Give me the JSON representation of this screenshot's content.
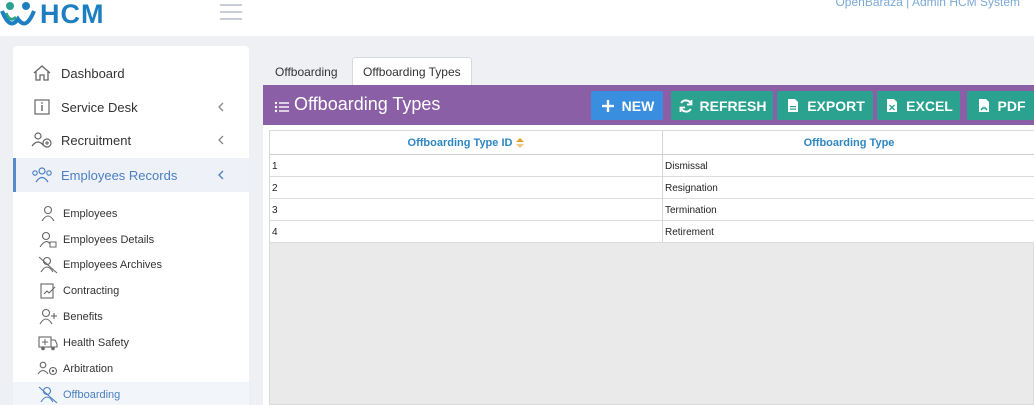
{
  "header": {
    "logo_text": "HCM",
    "system_label": "OpenBaraza | Admin HCM System"
  },
  "sidebar": {
    "items": [
      {
        "label": "Dashboard",
        "icon": "home-icon",
        "has_chevron": false
      },
      {
        "label": "Service Desk",
        "icon": "info-icon",
        "has_chevron": true
      },
      {
        "label": "Recruitment",
        "icon": "users-add-icon",
        "has_chevron": true
      },
      {
        "label": "Employees Records",
        "icon": "users-icon",
        "has_chevron": true,
        "active": true
      }
    ],
    "subitems": [
      {
        "label": "Employees",
        "icon": "user-icon"
      },
      {
        "label": "Employees Details",
        "icon": "user-tag-icon"
      },
      {
        "label": "Employees Archives",
        "icon": "user-slash-icon"
      },
      {
        "label": "Contracting",
        "icon": "contract-icon"
      },
      {
        "label": "Benefits",
        "icon": "user-plus-icon"
      },
      {
        "label": "Health Safety",
        "icon": "ambulance-icon"
      },
      {
        "label": "Arbitration",
        "icon": "users-gear-icon"
      },
      {
        "label": "Offboarding",
        "icon": "user-slash-icon",
        "active": true
      }
    ]
  },
  "tabs": [
    {
      "label": "Offboarding"
    },
    {
      "label": "Offboarding Types",
      "active": true
    }
  ],
  "panel": {
    "title": "Offboarding Types",
    "buttons": {
      "new": "NEW",
      "refresh": "REFRESH",
      "export": "EXPORT",
      "excel": "EXCEL",
      "pdf": "PDF"
    }
  },
  "table": {
    "columns": [
      "Offboarding Type ID",
      "Offboarding Type"
    ],
    "rows": [
      [
        "1",
        "Dismissal"
      ],
      [
        "2",
        "Resignation"
      ],
      [
        "3",
        "Termination"
      ],
      [
        "4",
        "Retirement"
      ]
    ]
  },
  "colors": {
    "panel_header": "#8a5fa6",
    "new_button": "#3a8ee0",
    "action_button": "#2aa28f",
    "column_header_text": "#2e86c1",
    "active_nav": "#4a7fc1"
  }
}
